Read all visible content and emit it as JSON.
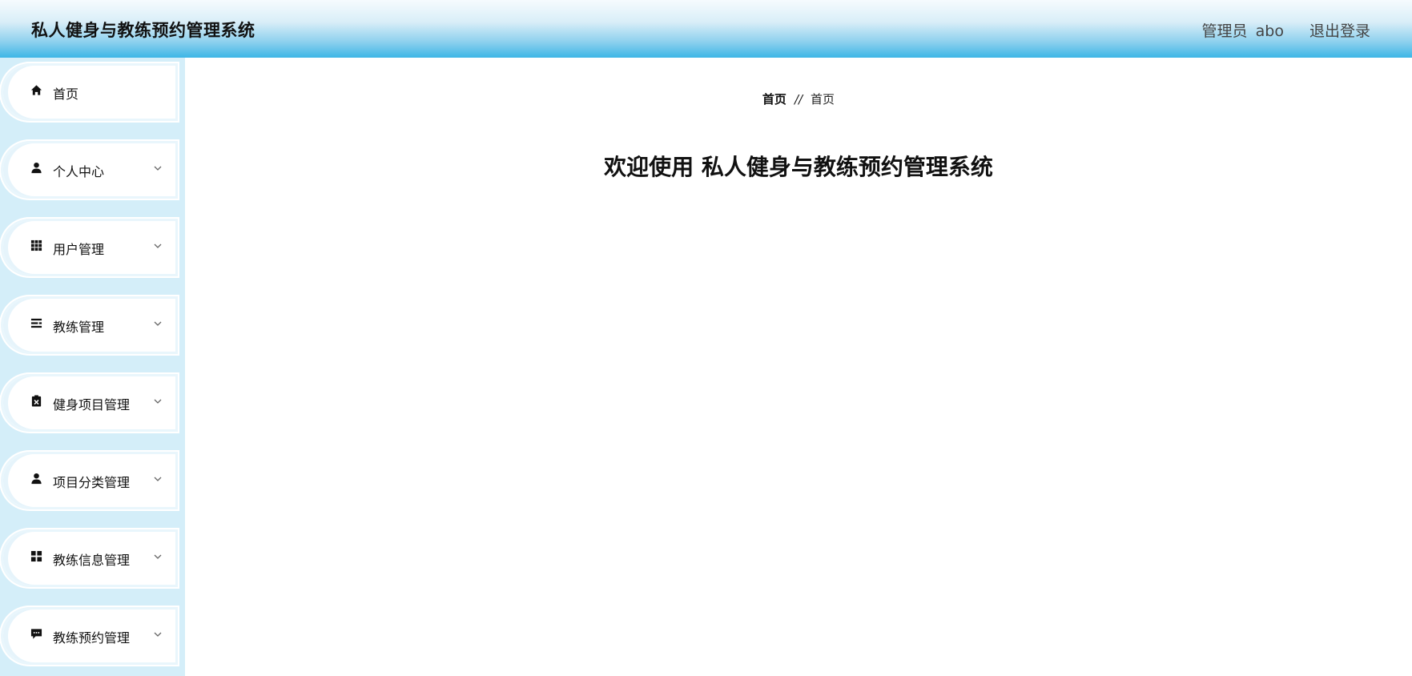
{
  "header": {
    "app_title": "私人健身与教练预约管理系统",
    "user_role": "管理员",
    "username": "abo",
    "logout_label": "退出登录",
    "colors": {
      "gradient_top": "#f6fbfe",
      "gradient_bottom": "#3db6e6"
    }
  },
  "sidebar": {
    "background": "#d4eef9",
    "items": [
      {
        "label": "首页",
        "icon": "home-icon",
        "expandable": false
      },
      {
        "label": "个人中心",
        "icon": "user-icon",
        "expandable": true
      },
      {
        "label": "用户管理",
        "icon": "grid-icon",
        "expandable": true
      },
      {
        "label": "教练管理",
        "icon": "list-icon",
        "expandable": true
      },
      {
        "label": "健身项目管理",
        "icon": "clipboard-icon",
        "expandable": true
      },
      {
        "label": "项目分类管理",
        "icon": "user-icon",
        "expandable": true
      },
      {
        "label": "教练信息管理",
        "icon": "dashboard-icon",
        "expandable": true
      },
      {
        "label": "教练预约管理",
        "icon": "chat-icon",
        "expandable": true
      }
    ]
  },
  "main": {
    "breadcrumb": {
      "root": "首页",
      "separator": "//",
      "current": "首页"
    },
    "welcome_prefix": "欢迎使用",
    "welcome_title": "私人健身与教练预约管理系统"
  }
}
